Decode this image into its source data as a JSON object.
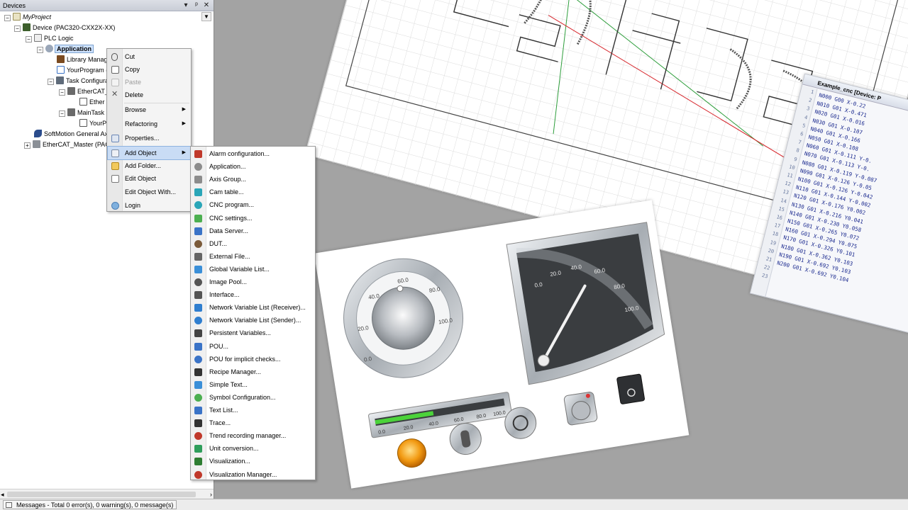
{
  "devices_panel": {
    "title": "Devices",
    "title_buttons": [
      "▾",
      "ᵖ",
      "✕"
    ],
    "tree": [
      {
        "label": "MyProject",
        "italic": true,
        "icon": "project-icon"
      },
      {
        "label": "Device (PAC320-CXX2X-XX)",
        "icon": "device-icon"
      },
      {
        "label": "PLC Logic",
        "icon": "plc-logic-icon"
      },
      {
        "label": "Application",
        "bold": true,
        "icon": "application-icon"
      },
      {
        "label": "Library Manag",
        "icon": "library-icon"
      },
      {
        "label": "YourProgram (",
        "icon": "program-icon"
      },
      {
        "label": "Task Configura",
        "icon": "task-config-icon"
      },
      {
        "label": "EtherCAT_",
        "icon": "task-icon"
      },
      {
        "label": "Ether",
        "icon": "ethercat-task-icon"
      },
      {
        "label": "MainTask",
        "icon": "task-icon"
      },
      {
        "label": "YourP",
        "icon": "program-call-icon"
      },
      {
        "label": "SoftMotion General Ax",
        "icon": "softmotion-icon"
      },
      {
        "label": "EtherCAT_Master (PAC",
        "icon": "ethercat-master-icon"
      }
    ]
  },
  "context_menu": {
    "items": [
      {
        "label": "Cut",
        "icon": "cut-icon",
        "enabled": true
      },
      {
        "label": "Copy",
        "icon": "copy-icon",
        "enabled": true
      },
      {
        "label": "Paste",
        "icon": "paste-icon",
        "enabled": false
      },
      {
        "label": "Delete",
        "icon": "delete-icon",
        "enabled": true
      },
      {
        "label": "Browse",
        "submenu": true
      },
      {
        "label": "Refactoring",
        "submenu": true
      },
      {
        "label": "Properties...",
        "icon": "properties-icon"
      },
      {
        "label": "Add Object",
        "icon": "add-object-icon",
        "submenu": true,
        "highlighted": true
      },
      {
        "label": "Add Folder...",
        "icon": "folder-icon"
      },
      {
        "label": "Edit Object",
        "icon": "edit-object-icon"
      },
      {
        "label": "Edit Object With..."
      },
      {
        "label": "Login",
        "icon": "login-icon"
      }
    ]
  },
  "add_object_submenu": {
    "items": [
      {
        "label": "Alarm configuration...",
        "icon": "alarm-config-icon",
        "color": "#c0392b"
      },
      {
        "label": "Application...",
        "icon": "application-icon",
        "color": "#8c8c8c"
      },
      {
        "label": "Axis Group...",
        "icon": "axis-group-icon",
        "color": "#8c8c8c"
      },
      {
        "label": "Cam table...",
        "icon": "cam-table-icon",
        "color": "#2aa6b8"
      },
      {
        "label": "CNC program...",
        "icon": "cnc-program-icon",
        "color": "#2aa6b8"
      },
      {
        "label": "CNC settings...",
        "icon": "cnc-settings-icon",
        "color": "#4caf50"
      },
      {
        "label": "Data Server...",
        "icon": "data-server-icon",
        "color": "#3a73c7"
      },
      {
        "label": "DUT...",
        "icon": "dut-icon",
        "color": "#7b5b3a"
      },
      {
        "label": "External File...",
        "icon": "external-file-icon",
        "color": "#666666"
      },
      {
        "label": "Global Variable List...",
        "icon": "gvl-icon",
        "color": "#3a8fd8"
      },
      {
        "label": "Image Pool...",
        "icon": "image-pool-icon",
        "color": "#555555"
      },
      {
        "label": "Interface...",
        "icon": "interface-icon",
        "color": "#555555"
      },
      {
        "label": "Network Variable List (Receiver)...",
        "icon": "nvl-receiver-icon",
        "color": "#2f7ecf"
      },
      {
        "label": "Network Variable List (Sender)...",
        "icon": "nvl-sender-icon",
        "color": "#2f7ecf"
      },
      {
        "label": "Persistent Variables...",
        "icon": "persistent-vars-icon",
        "color": "#444444"
      },
      {
        "label": "POU...",
        "icon": "pou-icon",
        "color": "#3a73c7"
      },
      {
        "label": "POU for implicit checks...",
        "icon": "pou-checks-icon",
        "color": "#3a73c7"
      },
      {
        "label": "Recipe Manager...",
        "icon": "recipe-manager-icon",
        "color": "#333333"
      },
      {
        "label": "Simple Text...",
        "icon": "simple-text-icon",
        "color": "#3a8fd8"
      },
      {
        "label": "Symbol Configuration...",
        "icon": "symbol-config-icon",
        "color": "#4caf50"
      },
      {
        "label": "Text List...",
        "icon": "text-list-icon",
        "color": "#3a73c7"
      },
      {
        "label": "Trace...",
        "icon": "trace-icon",
        "color": "#333333"
      },
      {
        "label": "Trend recording manager...",
        "icon": "trend-manager-icon",
        "color": "#c0392b"
      },
      {
        "label": "Unit conversion...",
        "icon": "unit-conversion-icon",
        "color": "#2e9e5b"
      },
      {
        "label": "Visualization...",
        "icon": "visualization-icon",
        "color": "#2e7d32"
      },
      {
        "label": "Visualization Manager...",
        "icon": "visualization-manager-icon",
        "color": "#c0392b"
      }
    ]
  },
  "status_bar": {
    "messages": "Messages - Total 0 error(s), 0 warning(s), 0 message(s)"
  },
  "cnc_editor": {
    "tab_title": "Example_cnc [Device: P",
    "line_numbers": [
      "1",
      "2",
      "3",
      "4",
      "5",
      "6",
      "7",
      "8",
      "9",
      "10",
      "11",
      "12",
      "13",
      "14",
      "15",
      "16",
      "17",
      "18",
      "19",
      "20",
      "21",
      "22",
      "23"
    ],
    "code_lines": [
      "N000 G00 X-0.22",
      "N010 G01 X-0.471",
      "N020 G01 X-0.016",
      "N030 G01 X-0.107",
      "N040 G01 X-0.166",
      "N050 G01 X-0.108",
      "N060 G01 X-0.111 Y-0.",
      "N070 G01 X-0.113 Y-0.",
      "N080 G01 X-0.119 Y-0.087",
      "N090 G01 X-0.126 Y-0.05",
      "N100 G01 X-0.126 Y-0.042",
      "N110 G01 X-0.144 Y-0.002",
      "N120 G01 X-0.176 Y0.002",
      "N130 G01 X-0.216 Y0.041",
      "N140 G01 X-0.230 Y0.058",
      "N150 G01 X-0.265 Y0.072",
      "N160 G01 X-0.294 Y0.075",
      "N170 G01 X-0.326 Y0.101",
      "N180 G01 X-0.362 Y0.103",
      "N190 G01 X-0.692 Y0.103",
      "N200 G01 X-0.692 Y0.104"
    ]
  },
  "visualization": {
    "knob_ticks": [
      "0.0",
      "20.0",
      "40.0",
      "60.0",
      "80.0",
      "100.0"
    ],
    "gauge_ticks": [
      "0.0",
      "20.0",
      "40.0",
      "60.0",
      "80.0",
      "100.0"
    ],
    "bar_ticks": [
      "0.0",
      "20.0",
      "40.0",
      "60.0",
      "80.0",
      "100.0"
    ],
    "bar_fill": 0.45,
    "lamp_color": "#f29a12"
  }
}
